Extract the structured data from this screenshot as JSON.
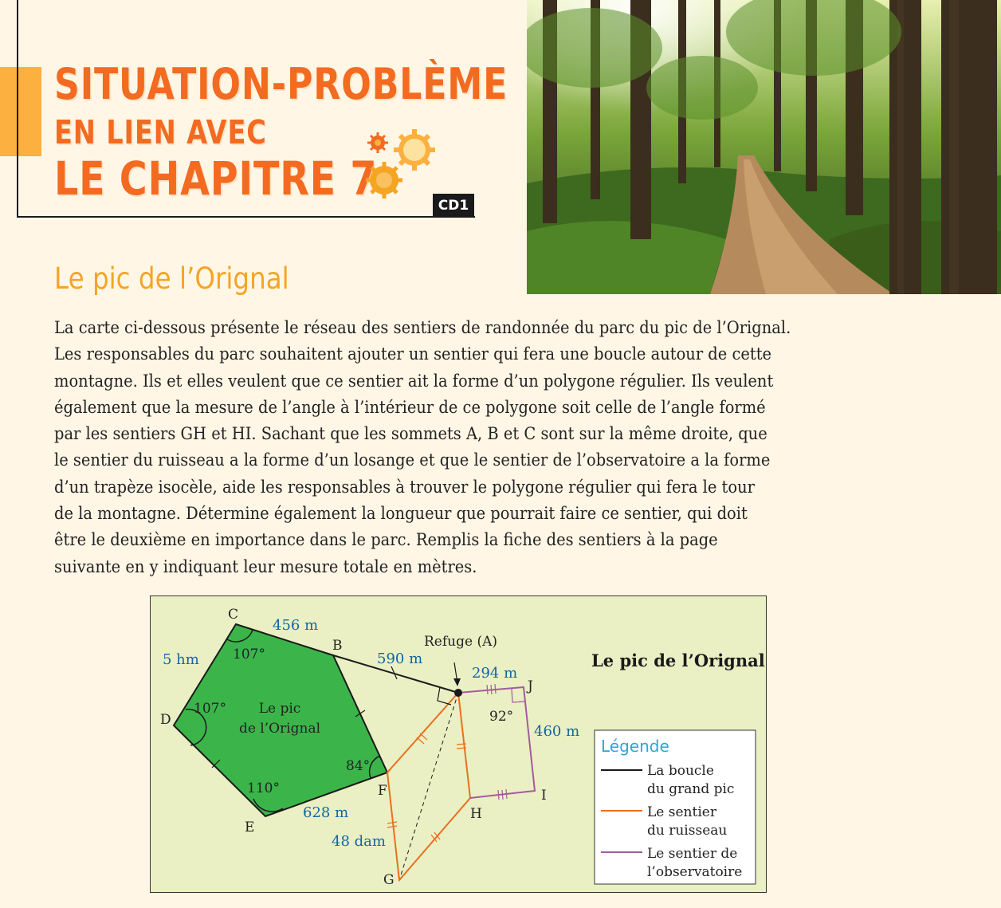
{
  "header": {
    "line1": "SITUATION-PROBLÈME",
    "line2": "EN LIEN AVEC",
    "line3": "LE CHAPITRE 7",
    "badge": "CD1"
  },
  "section_title": "Le pic de l’Orignal",
  "paragraph_lines": [
    "La carte ci-dessous présente le réseau des sentiers de randonnée du parc du pic de l’Orignal.",
    "Les responsables du parc souhaitent ajouter un sentier qui fera une boucle autour de cette",
    "montagne. Ils et elles veulent que ce sentier ait la forme d’un polygone régulier. Ils veulent",
    "également que la mesure de l’angle à l’intérieur de ce polygone soit celle de l’angle formé",
    "par les sentiers GH et HI. Sachant que les sommets A, B et C sont sur la même droite, que",
    "le sentier du ruisseau a la forme d’un losange et que le sentier de l’observatoire a la forme",
    "d’un trapèze isocèle, aide les responsables à trouver le polygone régulier qui fera le tour",
    "de la montagne. Détermine également la longueur que pourrait faire ce sentier, qui doit",
    "être le deuxième en importance dans le parc. Remplis la fiche des sentiers à la page",
    "suivante en y indiquant leur mesure totale en mètres."
  ],
  "map": {
    "title": "Le pic de l’Orignal",
    "points": {
      "A": "Refuge (A)",
      "B": "B",
      "C": "C",
      "D": "D",
      "E": "E",
      "F": "F",
      "G": "G",
      "H": "H",
      "I": "I",
      "J": "J"
    },
    "peak_label_1": "Le pic",
    "peak_label_2": "de l’Orignal",
    "measures": {
      "cb": "456 m",
      "cd": "5 hm",
      "ba": "590 m",
      "aj": "294 m",
      "ji": "460 m",
      "ef": "628 m",
      "fg": "48 dam"
    },
    "angles": {
      "c": "107°",
      "d": "107°",
      "e": "110°",
      "f": "84°",
      "j": "92°"
    },
    "legend": {
      "title": "Légende",
      "items": [
        {
          "line1": "La boucle",
          "line2": "du grand pic",
          "color": "#1a1a1a"
        },
        {
          "line1": "Le sentier",
          "line2": "du ruisseau",
          "color": "#e8701e"
        },
        {
          "line1": "Le sentier de",
          "line2": "l’observatoire",
          "color": "#a45a9e"
        }
      ]
    },
    "colors": {
      "peak": "#3bb54a",
      "background": "#eaf0c4",
      "measure": "#1464a5"
    }
  }
}
